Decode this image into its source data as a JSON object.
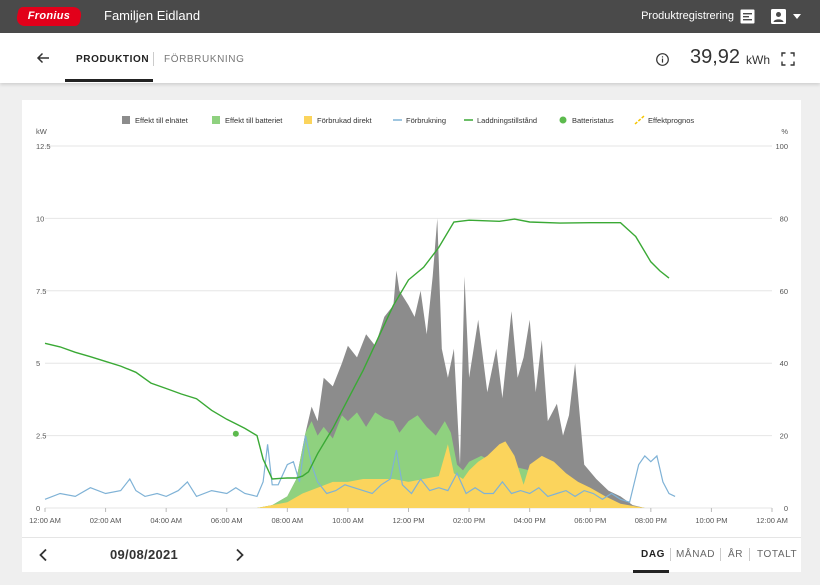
{
  "topbar": {
    "logo_text": "Fronius",
    "site_name": "Familjen Eidland",
    "registration_label": "Produktregistrering"
  },
  "tabs": {
    "production": "PRODUKTION",
    "consumption": "FÖRBRUKNING"
  },
  "summary": {
    "value": "39,92",
    "unit": "kWh"
  },
  "navigation": {
    "date": "09/08/2021",
    "periods": [
      "DAG",
      "MÅNAD",
      "ÅR",
      "TOTALT"
    ],
    "active_period": "DAG"
  },
  "colors": {
    "grid": "#8c8c8c",
    "battery": "#8fd17f",
    "direct": "#fbd45c",
    "consumption": "#7fb2d6",
    "state_of_charge": "#3aa935",
    "battery_status": "#5cba4d",
    "forecast": "#f5c500",
    "brand": "#e2001a"
  },
  "chart_data": {
    "type": "area",
    "legend": [
      {
        "label": "Effekt till elnätet",
        "marker": "square",
        "color": "#8c8c8c"
      },
      {
        "label": "Effekt till batteriet",
        "marker": "square",
        "color": "#8fd17f"
      },
      {
        "label": "Förbrukad direkt",
        "marker": "square",
        "color": "#fbd45c"
      },
      {
        "label": "Förbrukning",
        "marker": "line",
        "color": "#7fb2d6"
      },
      {
        "label": "Laddningstillstånd",
        "marker": "line",
        "color": "#3aa935"
      },
      {
        "label": "Batteristatus",
        "marker": "dot",
        "color": "#5cba4d"
      },
      {
        "label": "Effektprognos",
        "marker": "dash",
        "color": "#f5c500"
      }
    ],
    "y_left": {
      "unit": "kW",
      "min": 0,
      "max": 12.5,
      "ticks": [
        "0",
        "2.5",
        "5",
        "7.5",
        "10",
        "12.5"
      ]
    },
    "y_right": {
      "unit": "%",
      "min": 0,
      "max": 100,
      "ticks": [
        "0",
        "20",
        "40",
        "60",
        "80",
        "100"
      ]
    },
    "x_ticks": [
      "12:00 AM",
      "02:00 AM",
      "04:00 AM",
      "06:00 AM",
      "08:00 AM",
      "10:00 AM",
      "12:00 PM",
      "02:00 PM",
      "04:00 PM",
      "06:00 PM",
      "08:00 PM",
      "10:00 PM",
      "12:00 AM"
    ],
    "x_unit": "hours",
    "stacked_total_kw": [
      [
        7.0,
        0
      ],
      [
        7.5,
        0.1
      ],
      [
        8.0,
        0.4
      ],
      [
        8.3,
        1.0
      ],
      [
        8.6,
        2.6
      ],
      [
        8.8,
        3.5
      ],
      [
        9.0,
        3.0
      ],
      [
        9.2,
        4.5
      ],
      [
        9.5,
        4.2
      ],
      [
        9.8,
        5.0
      ],
      [
        10.0,
        5.6
      ],
      [
        10.3,
        5.2
      ],
      [
        10.6,
        6.0
      ],
      [
        10.9,
        5.6
      ],
      [
        11.2,
        6.6
      ],
      [
        11.5,
        7.0
      ],
      [
        11.6,
        8.2
      ],
      [
        11.7,
        7.5
      ],
      [
        12.0,
        7.0
      ],
      [
        12.2,
        6.6
      ],
      [
        12.4,
        7.5
      ],
      [
        12.6,
        6.0
      ],
      [
        12.8,
        8.0
      ],
      [
        12.95,
        10.0
      ],
      [
        13.1,
        5.5
      ],
      [
        13.3,
        4.5
      ],
      [
        13.5,
        5.5
      ],
      [
        13.7,
        1.5
      ],
      [
        13.85,
        8.0
      ],
      [
        14.0,
        4.5
      ],
      [
        14.3,
        6.5
      ],
      [
        14.6,
        4.0
      ],
      [
        14.9,
        5.5
      ],
      [
        15.1,
        3.8
      ],
      [
        15.4,
        6.8
      ],
      [
        15.6,
        4.5
      ],
      [
        15.8,
        5.2
      ],
      [
        16.0,
        6.5
      ],
      [
        16.2,
        4.0
      ],
      [
        16.4,
        5.8
      ],
      [
        16.6,
        3.0
      ],
      [
        16.9,
        3.6
      ],
      [
        17.1,
        2.5
      ],
      [
        17.3,
        3.2
      ],
      [
        17.5,
        5.0
      ],
      [
        17.8,
        1.5
      ],
      [
        18.2,
        1.0
      ],
      [
        18.6,
        0.6
      ],
      [
        19.0,
        0.4
      ],
      [
        19.4,
        0.1
      ],
      [
        19.8,
        0
      ]
    ],
    "battery_top_kw": [
      [
        7.0,
        0
      ],
      [
        7.5,
        0.1
      ],
      [
        8.0,
        0.4
      ],
      [
        8.3,
        1.0
      ],
      [
        8.6,
        2.6
      ],
      [
        8.8,
        3.0
      ],
      [
        9.0,
        2.5
      ],
      [
        9.2,
        2.8
      ],
      [
        9.5,
        2.4
      ],
      [
        9.8,
        3.2
      ],
      [
        10.0,
        3.0
      ],
      [
        10.3,
        3.3
      ],
      [
        10.6,
        2.8
      ],
      [
        10.9,
        3.3
      ],
      [
        11.2,
        3.1
      ],
      [
        11.5,
        3.0
      ],
      [
        11.7,
        2.6
      ],
      [
        12.0,
        3.0
      ],
      [
        12.3,
        3.2
      ],
      [
        12.6,
        2.8
      ],
      [
        12.9,
        2.5
      ],
      [
        13.2,
        3.0
      ],
      [
        13.4,
        2.6
      ],
      [
        13.6,
        1.5
      ],
      [
        13.8,
        1.3
      ],
      [
        14.0,
        1.6
      ],
      [
        14.4,
        1.8
      ],
      [
        14.8,
        1.6
      ],
      [
        15.2,
        1.8
      ],
      [
        15.6,
        1.4
      ],
      [
        16.0,
        1.3
      ],
      [
        16.5,
        1.0
      ],
      [
        17.0,
        0.8
      ],
      [
        17.5,
        0.6
      ],
      [
        18.0,
        0.4
      ],
      [
        18.5,
        0.2
      ],
      [
        19.0,
        0.1
      ],
      [
        19.8,
        0
      ]
    ],
    "direct_kw": [
      [
        7.0,
        0
      ],
      [
        7.5,
        0.1
      ],
      [
        8.0,
        0.2
      ],
      [
        8.5,
        0.5
      ],
      [
        9.0,
        0.7
      ],
      [
        9.5,
        0.9
      ],
      [
        10.0,
        0.9
      ],
      [
        10.5,
        1.0
      ],
      [
        11.0,
        1.0
      ],
      [
        11.5,
        1.0
      ],
      [
        12.0,
        0.9
      ],
      [
        12.5,
        1.0
      ],
      [
        13.0,
        1.1
      ],
      [
        13.3,
        2.2
      ],
      [
        13.5,
        1.2
      ],
      [
        13.8,
        1.0
      ],
      [
        14.0,
        1.3
      ],
      [
        14.3,
        1.6
      ],
      [
        14.6,
        1.8
      ],
      [
        14.8,
        2.0
      ],
      [
        15.0,
        2.2
      ],
      [
        15.2,
        2.3
      ],
      [
        15.5,
        1.8
      ],
      [
        15.8,
        0.8
      ],
      [
        16.0,
        1.5
      ],
      [
        16.4,
        1.8
      ],
      [
        16.8,
        1.6
      ],
      [
        17.2,
        1.2
      ],
      [
        17.6,
        0.9
      ],
      [
        18.0,
        0.7
      ],
      [
        18.5,
        0.4
      ],
      [
        19.0,
        0.15
      ],
      [
        19.8,
        0
      ]
    ],
    "consumption_kw": [
      [
        0,
        0.3
      ],
      [
        0.5,
        0.5
      ],
      [
        1.0,
        0.4
      ],
      [
        1.5,
        0.7
      ],
      [
        2.0,
        0.5
      ],
      [
        2.5,
        0.6
      ],
      [
        2.8,
        1.0
      ],
      [
        3.0,
        0.6
      ],
      [
        3.3,
        0.4
      ],
      [
        3.7,
        0.5
      ],
      [
        4.0,
        0.4
      ],
      [
        4.4,
        0.6
      ],
      [
        4.7,
        0.9
      ],
      [
        5.0,
        0.4
      ],
      [
        5.5,
        0.6
      ],
      [
        6.0,
        0.5
      ],
      [
        6.3,
        0.7
      ],
      [
        6.6,
        0.5
      ],
      [
        7.0,
        0.4
      ],
      [
        7.2,
        0.9
      ],
      [
        7.35,
        2.2
      ],
      [
        7.5,
        0.8
      ],
      [
        7.7,
        0.8
      ],
      [
        8.0,
        1.5
      ],
      [
        8.2,
        1.6
      ],
      [
        8.4,
        0.9
      ],
      [
        8.6,
        2.5
      ],
      [
        8.8,
        1.5
      ],
      [
        9.0,
        0.9
      ],
      [
        9.3,
        0.5
      ],
      [
        9.6,
        0.6
      ],
      [
        9.9,
        0.8
      ],
      [
        10.2,
        0.7
      ],
      [
        10.5,
        0.6
      ],
      [
        10.8,
        0.5
      ],
      [
        11.1,
        0.8
      ],
      [
        11.4,
        1.0
      ],
      [
        11.6,
        2.0
      ],
      [
        11.8,
        0.8
      ],
      [
        12.1,
        0.5
      ],
      [
        12.4,
        1.0
      ],
      [
        12.7,
        0.6
      ],
      [
        13.0,
        0.7
      ],
      [
        13.3,
        0.6
      ],
      [
        13.6,
        1.2
      ],
      [
        13.9,
        0.5
      ],
      [
        14.2,
        0.7
      ],
      [
        14.5,
        0.5
      ],
      [
        14.8,
        0.5
      ],
      [
        15.1,
        0.9
      ],
      [
        15.4,
        0.5
      ],
      [
        15.7,
        0.6
      ],
      [
        16.0,
        0.5
      ],
      [
        16.3,
        0.7
      ],
      [
        16.6,
        0.4
      ],
      [
        16.9,
        0.5
      ],
      [
        17.2,
        0.6
      ],
      [
        17.5,
        0.4
      ],
      [
        17.8,
        0.6
      ],
      [
        18.1,
        0.5
      ],
      [
        18.4,
        0.3
      ],
      [
        18.7,
        0.5
      ],
      [
        19.0,
        0.3
      ],
      [
        19.3,
        0.2
      ],
      [
        19.6,
        1.5
      ],
      [
        19.8,
        1.8
      ],
      [
        20.0,
        1.6
      ],
      [
        20.2,
        1.8
      ],
      [
        20.4,
        0.9
      ],
      [
        20.6,
        0.5
      ],
      [
        20.8,
        0.4
      ]
    ],
    "state_of_charge_pct": [
      [
        0,
        45.5
      ],
      [
        0.5,
        44.5
      ],
      [
        1.0,
        43.0
      ],
      [
        1.5,
        41.8
      ],
      [
        2.0,
        40.5
      ],
      [
        2.5,
        39.2
      ],
      [
        3.0,
        37.5
      ],
      [
        3.5,
        34.5
      ],
      [
        4.0,
        33.0
      ],
      [
        4.5,
        31.5
      ],
      [
        5.0,
        30.2
      ],
      [
        5.5,
        27.0
      ],
      [
        6.0,
        24.5
      ],
      [
        6.3,
        23.3
      ],
      [
        6.6,
        22.0
      ],
      [
        7.0,
        20.0
      ],
      [
        7.2,
        13.5
      ],
      [
        7.5,
        8.0
      ],
      [
        7.8,
        8.2
      ],
      [
        8.0,
        8.3
      ],
      [
        8.3,
        8.3
      ],
      [
        8.5,
        8.8
      ],
      [
        8.7,
        10.0
      ],
      [
        9.0,
        15.0
      ],
      [
        9.5,
        22.0
      ],
      [
        10.0,
        30.0
      ],
      [
        10.5,
        38.0
      ],
      [
        11.0,
        47.0
      ],
      [
        11.5,
        56.0
      ],
      [
        12.0,
        63.0
      ],
      [
        12.5,
        66.5
      ],
      [
        13.0,
        72.0
      ],
      [
        13.5,
        79.0
      ],
      [
        14.0,
        79.5
      ],
      [
        15.0,
        79.2
      ],
      [
        15.5,
        79.8
      ],
      [
        16.0,
        79.0
      ],
      [
        17.0,
        78.7
      ],
      [
        18.0,
        78.8
      ],
      [
        19.0,
        78.8
      ],
      [
        19.5,
        75.0
      ],
      [
        20.0,
        68.0
      ],
      [
        20.3,
        65.5
      ],
      [
        20.6,
        63.5
      ]
    ],
    "battery_status_pct": [
      [
        6.3,
        20.5
      ]
    ]
  }
}
